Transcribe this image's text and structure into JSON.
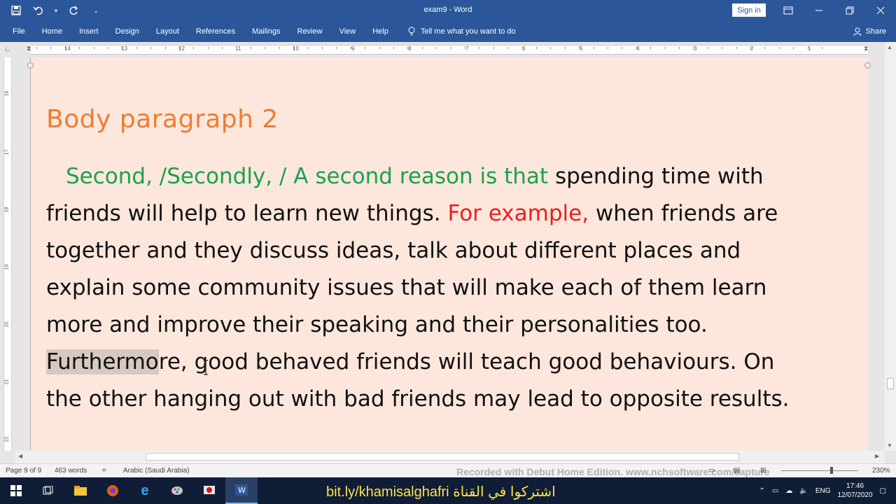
{
  "window": {
    "title": "exam9 - Word",
    "sign_in": "Sign in"
  },
  "ribbon": {
    "tabs": [
      "File",
      "Home",
      "Insert",
      "Design",
      "Layout",
      "References",
      "Mailings",
      "Review",
      "View",
      "Help"
    ],
    "tell_me": "Tell me what you want to do",
    "share": "Share"
  },
  "ruler": {
    "numbers": [
      "14",
      "13",
      "12",
      "11",
      "10",
      "9",
      "8",
      "7",
      "6",
      "5",
      "4",
      "3",
      "2",
      "1"
    ],
    "vertical_numbers": [
      "16",
      "17",
      "18",
      "19",
      "20",
      "21",
      "22"
    ]
  },
  "document": {
    "heading": "Body paragraph 2",
    "lines": [
      [
        {
          "t": "Second, /Secondly, / A second reason is that",
          "c": "green",
          "indent": true
        },
        {
          "t": " spending time with",
          "c": "normal"
        }
      ],
      [
        {
          "t": "friends will help to learn new things. ",
          "c": "normal"
        },
        {
          "t": "For example,",
          "c": "red"
        },
        {
          "t": " when friends are",
          "c": "normal"
        }
      ],
      [
        {
          "t": "together and they discuss ideas, talk about different places and",
          "c": "normal"
        }
      ],
      [
        {
          "t": "explain some community issues that will make each of them learn",
          "c": "normal"
        }
      ],
      [
        {
          "t": "more and improve their speaking and their personalities too.",
          "c": "normal"
        }
      ],
      [
        {
          "t": "Furthermo",
          "c": "highlight"
        },
        {
          "t": "re, good behaved friends will teach good behaviours. On",
          "c": "normal"
        }
      ],
      [
        {
          "t": "the other hanging out with bad friends may lead to opposite results.",
          "c": "normal"
        }
      ]
    ]
  },
  "status": {
    "page": "Page 9 of 9",
    "words": "463 words",
    "language": "Arabic (Saudi Arabia)",
    "watermark": "Recorded with Debut Home Edition. www.nchsoftware.com/capture",
    "zoom": "230%"
  },
  "taskbar": {
    "banner": "bit.ly/khamisalghafri اشتركوا في القناة",
    "lang": "ENG",
    "time": "17:46",
    "date": "12/07/2020"
  },
  "colors": {
    "title_bar": "#2b579a",
    "heading": "#ed7d31",
    "green": "#1aa34a",
    "red": "#e8201f",
    "page": "#fde7dd"
  }
}
